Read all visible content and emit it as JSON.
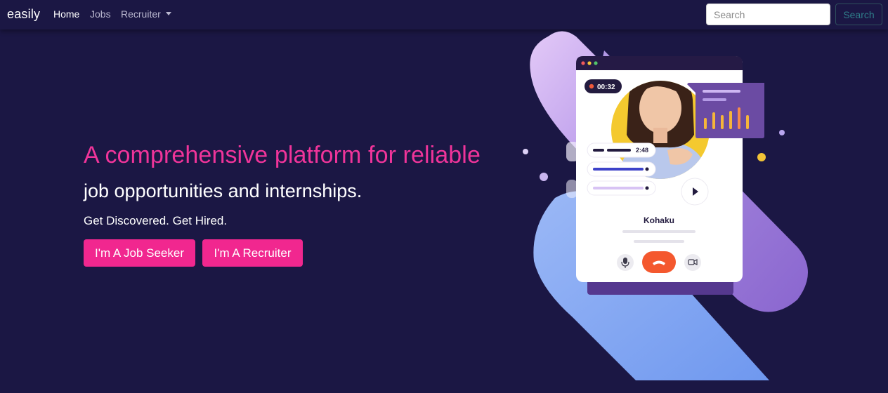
{
  "nav": {
    "brand": "easily",
    "links": [
      {
        "label": "Home",
        "active": true
      },
      {
        "label": "Jobs",
        "active": false
      },
      {
        "label": "Recruiter",
        "active": false,
        "dropdown": true
      }
    ],
    "search": {
      "placeholder": "Search",
      "button_label": "Search"
    }
  },
  "hero": {
    "title_line1": "A comprehensive platform for reliable",
    "title_line2": "job opportunities and internships.",
    "subtitle": "Get Discovered. Get Hired.",
    "buttons": {
      "job_seeker": "I'm A Job Seeker",
      "recruiter": "I'm A Recruiter"
    }
  },
  "illustration": {
    "timer": "00:32",
    "audio_duration": "2:48",
    "caller_name": "Kohaku",
    "icons": [
      "microphone-icon",
      "hang-up-icon",
      "video-camera-icon",
      "play-icon"
    ]
  },
  "colors": {
    "background": "#1b1744",
    "accent_pink": "#f1278f",
    "title_pink": "#f0349a",
    "hangup_orange": "#f4582e",
    "chart_purple": "#6b4ba3"
  }
}
